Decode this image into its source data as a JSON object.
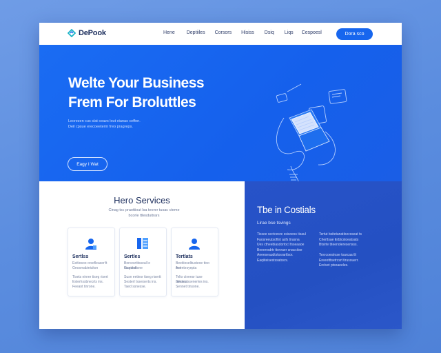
{
  "brand": {
    "name": "DePook"
  },
  "nav": {
    "links": [
      "Hene",
      "Deptiiles",
      "Corsors",
      "Hisiss",
      "Dsiq",
      "Liqs",
      "Cespoesl"
    ],
    "cta": "Dora sco"
  },
  "hero": {
    "title_line1": "Welte Your Business",
    "title_line2": "Frem For Broluttles",
    "subtitle_line1": "Lecrezen cus slat ceazs lout ctanas ceffen.",
    "subtitle_line2": "Deil cpsue erecoeeterm freo pragreps.",
    "button": "Eagy I Wat"
  },
  "services": {
    "title": "Hero Services",
    "subtitle_line1": "Cinag tsc praottiout lsa teorer tusac cteme",
    "subtitle_line2": "bcorle ttlesduitrars",
    "cards": [
      {
        "icon": "user-icon",
        "title": "Sertlss",
        "lines": [
          "Eeitiosoo orsofleaser'tt",
          "Geosmabieiciton",
          "Tisets nirner tiseg risert",
          "Esterhssbnecrts ins.",
          "Feeant tinrone."
        ]
      },
      {
        "icon": "document-icon",
        "title": "Sertles",
        "lines": [
          "Bercesrittsseal le Gaeisoit",
          "Incgolatione",
          "Susn eetiesr tiseg risertt",
          "Sesterl Isserserts ins.",
          "Taed ssnesse."
        ]
      },
      {
        "icon": "user-icon",
        "title": "Tertlats",
        "lines": [
          "Beeitioselitusteoe ttoo tret",
          "Asentesyepta",
          "Telio ctveesr tuse rideses",
          "Sesteutssenertes ins.",
          "Sennet tinsone."
        ]
      }
    ]
  },
  "cost": {
    "title": "Tbe in Costials",
    "subtitle": "Lirae bse tsvings",
    "col1": [
      "Tissee sectcesre ssisoess tisaul",
      "Faosreeutsoftnt asfs tirasna",
      "Ues ctheebiasdortocl fsseaaoe",
      "Beeerrsdrtr ttovraer snaccitse",
      "Aeeeseaudtstosrartlsor.",
      "Eaqiiteisestssatssrs."
    ],
    "col2": [
      "Tertut bsitetanatloecsseat ts",
      "Chertlsae Erbtcstoeatsats",
      "Btsirte titeenoleresensss.",
      "",
      "Tesrcoestrsse tsarcaa tlt",
      "Ereeotttsetrcsrt tirusouerr.",
      "Erelvet ptsoaeeles."
    ]
  },
  "colors": {
    "hero_blue": "#1766ee",
    "panel_blue": "#2753c9",
    "background_blue": "#5b8ddf"
  }
}
